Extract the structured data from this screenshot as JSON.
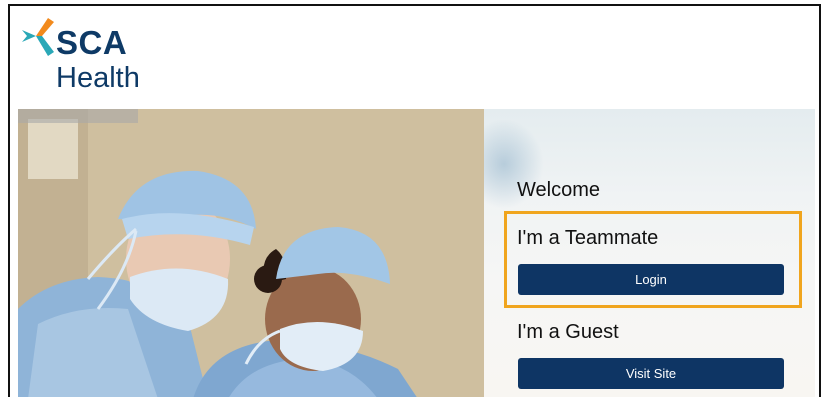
{
  "brand": {
    "name_top": "SCA",
    "name_bottom": "Health",
    "colors": {
      "navy": "#0e3a66",
      "orange": "#f0a51e",
      "teal": "#2aa8b7"
    }
  },
  "panel": {
    "welcome": "Welcome",
    "teammate_heading": "I'm a Teammate",
    "login_label": "Login",
    "guest_heading": "I'm a Guest",
    "visit_label": "Visit Site"
  },
  "colors": {
    "button_bg": "#0e3564",
    "highlight": "#f0a51e"
  }
}
